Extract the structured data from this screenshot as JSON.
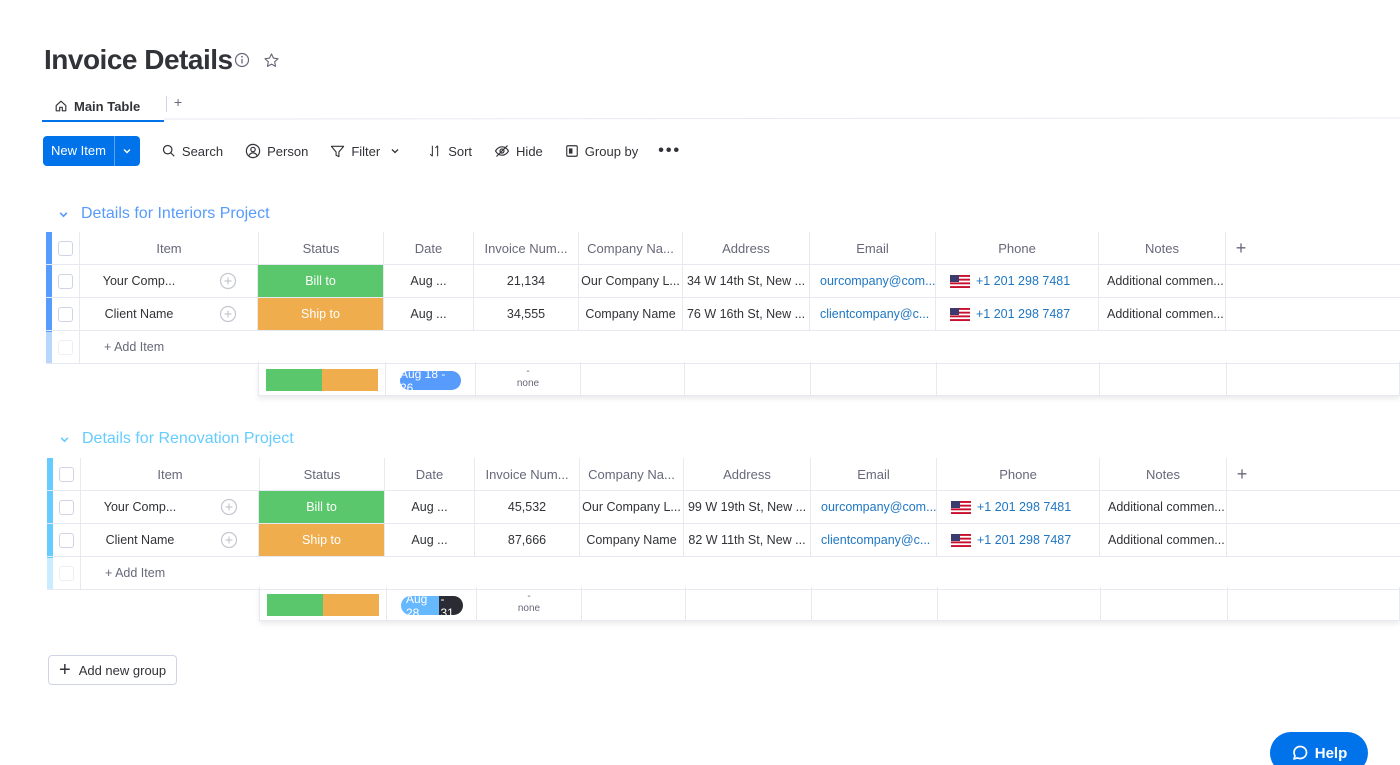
{
  "page": {
    "title": "Invoice Details",
    "info_icon": "info-icon",
    "star_icon": "star-icon"
  },
  "tabs": {
    "main_label": "Main Table",
    "add_label": "+"
  },
  "toolbar": {
    "new_item_label": "New Item",
    "search_label": "Search",
    "person_label": "Person",
    "filter_label": "Filter",
    "sort_label": "Sort",
    "hide_label": "Hide",
    "group_by_label": "Group by",
    "more_label": "•••"
  },
  "columns": [
    "Item",
    "Status",
    "Date",
    "Invoice Num...",
    "Company Na...",
    "Address",
    "Email",
    "Phone",
    "Notes"
  ],
  "groups": [
    {
      "title": "Details for Interiors Project",
      "color": "#579bfc",
      "rows": [
        {
          "item": "Your Comp...",
          "status": "Bill to",
          "date": "Aug ...",
          "invoice": "21,134",
          "company": "Our Company L...",
          "address": "34 W 14th St, New ...",
          "email": "ourcompany@com...",
          "phone": "+1 201 298 7481",
          "notes": "Additional commen..."
        },
        {
          "item": "Client Name",
          "status": "Ship to",
          "date": "Aug ...",
          "invoice": "34,555",
          "company": "Company Name",
          "address": "76 W 16th St, New ...",
          "email": "clientcompany@c...",
          "phone": "+1 201 298 7487",
          "notes": "Additional commen..."
        }
      ],
      "add_item_label": "+ Add Item",
      "summary_date": "Aug 18 - 26",
      "summary_invoice_dash": "-",
      "summary_invoice_none": "none"
    },
    {
      "title": "Details for Renovation Project",
      "color": "#66ccff",
      "rows": [
        {
          "item": "Your Comp...",
          "status": "Bill to",
          "date": "Aug ...",
          "invoice": "45,532",
          "company": "Our Company L...",
          "address": "99 W 19th St, New ...",
          "email": "ourcompany@com...",
          "phone": "+1 201 298 7481",
          "notes": "Additional commen..."
        },
        {
          "item": "Client Name",
          "status": "Ship to",
          "date": "Aug ...",
          "invoice": "87,666",
          "company": "Company Name",
          "address": "82 W 11th St, New ...",
          "email": "clientcompany@c...",
          "phone": "+1 201 298 7487",
          "notes": "Additional commen..."
        }
      ],
      "add_item_label": "+ Add Item",
      "summary_date_a": "Aug 28",
      "summary_date_b": "- 31",
      "summary_invoice_dash": "-",
      "summary_invoice_none": "none"
    }
  ],
  "status_colors": {
    "bill_to": "#5bc76c",
    "ship_to": "#f0ad4e"
  },
  "status_split": {
    "bill_to": 0.5,
    "ship_to": 0.5
  },
  "add_group_label": "Add new group",
  "help_label": "Help",
  "accent": "#0073ea"
}
